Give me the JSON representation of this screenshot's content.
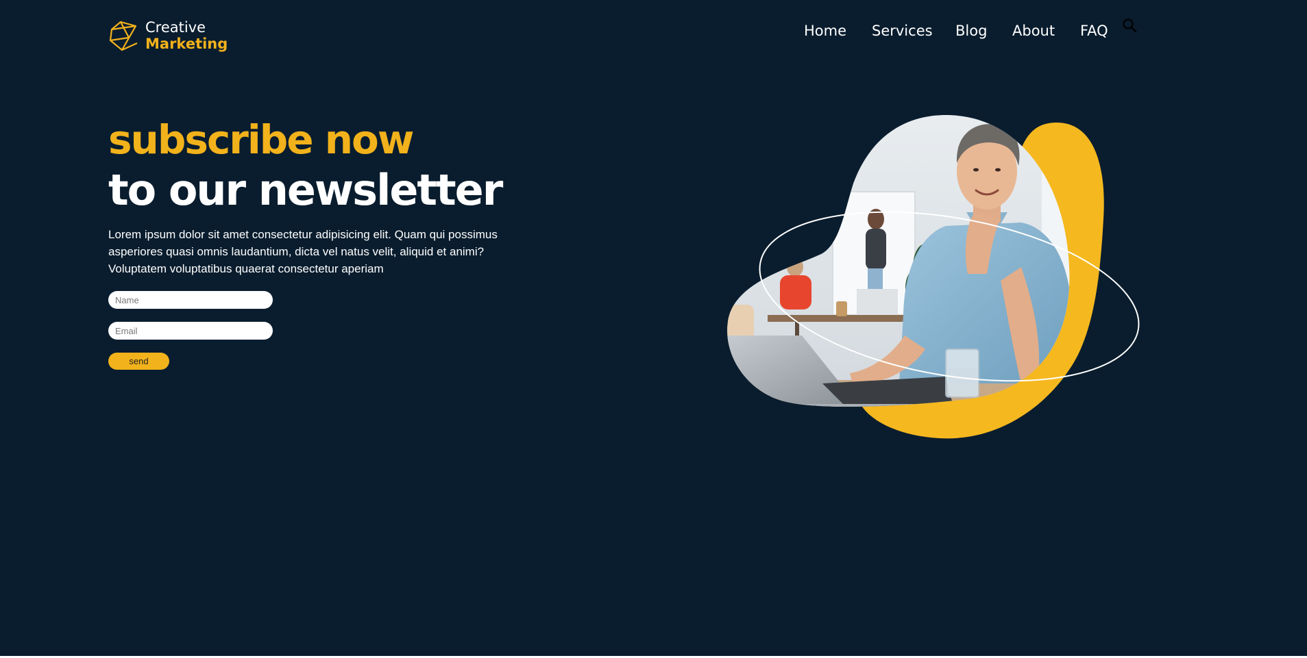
{
  "header": {
    "logo": {
      "line1": "Creative",
      "line2": "Marketing"
    },
    "nav": [
      {
        "label": "Home"
      },
      {
        "label": "Services"
      },
      {
        "label": "Blog"
      },
      {
        "label": "About"
      },
      {
        "label": "FAQ"
      }
    ],
    "search_icon": "search-icon"
  },
  "hero": {
    "headline_accent": "subscribe now",
    "headline_main": "to our newsletter",
    "lead": "Lorem ipsum dolor sit amet consectetur adipisicing elit. Quam qui possimus asperiores quasi omnis laudantium, dicta vel natus velit, aliquid et animi? Voluptatem voluptatibus quaerat consectetur aperiam",
    "form": {
      "name_placeholder": "Name",
      "email_placeholder": "Email",
      "send_label": "send"
    },
    "image_description_icon": "person-at-laptop-photo"
  },
  "colors": {
    "background": "#0a1d2e",
    "accent": "#f2b21b",
    "text": "#ffffff"
  }
}
